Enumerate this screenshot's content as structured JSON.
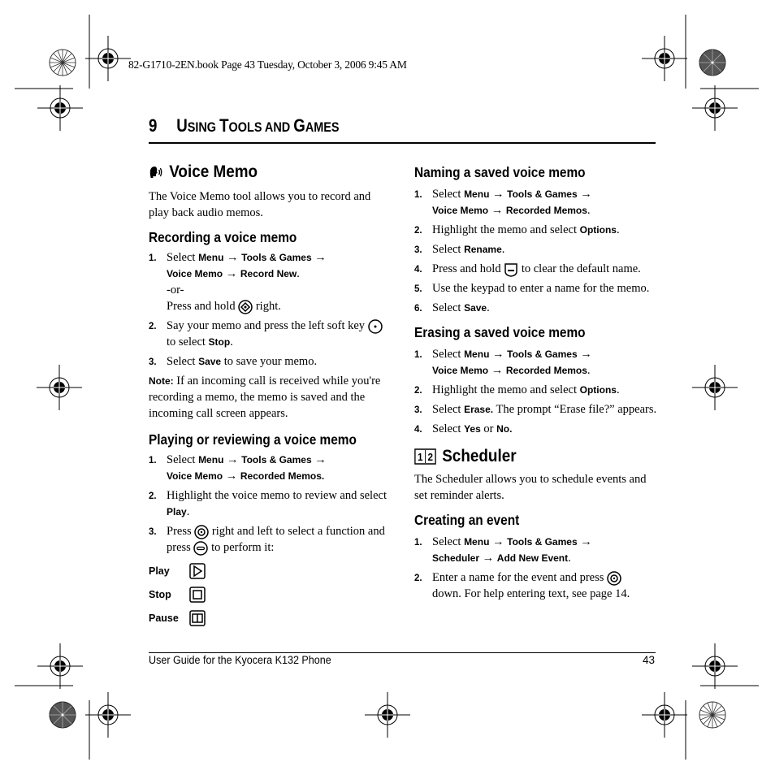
{
  "slug": "82-G1710-2EN.book  Page 43  Tuesday, October 3, 2006  9:45 AM",
  "chapter": {
    "number": "9",
    "title_parts": [
      {
        "t": "U",
        "cap": true
      },
      {
        "t": "SING ",
        "cap": false
      },
      {
        "t": "T",
        "cap": true
      },
      {
        "t": "OOLS AND ",
        "cap": false
      },
      {
        "t": "G",
        "cap": true
      },
      {
        "t": "AMES",
        "cap": false
      }
    ]
  },
  "voice_memo": {
    "title": "Voice Memo",
    "icon": "voice-memo-icon",
    "intro": "The Voice Memo tool allows you to record and play back audio memos.",
    "recording": {
      "heading": "Recording a voice memo",
      "step1_select": "Select",
      "step1_menu": "Menu",
      "step1_tools": "Tools & Games",
      "step1_voice": "Voice Memo",
      "step1_record": "Record New",
      "or": "-or-",
      "step1_alt_a": "Press and hold",
      "step1_alt_b": "right.",
      "step2_a": "Say your memo and press the left soft key",
      "step2_b": "to select",
      "step2_stop": "Stop",
      "step3_a": "Select",
      "step3_save": "Save",
      "step3_b": "to save your memo.",
      "note_label": "Note:",
      "note_text": "If an incoming call is received while you're recording a memo, the memo is saved and the incoming call screen appears."
    },
    "playing": {
      "heading": "Playing or reviewing a voice memo",
      "step1_select": "Select",
      "step1_menu": "Menu",
      "step1_tools": "Tools & Games",
      "step1_voice": "Voice Memo",
      "step1_recorded": "Recorded Memos.",
      "step2_a": "Highlight the voice memo to review and select",
      "step2_play": "Play",
      "step3_a": "Press",
      "step3_b": "right and left to select a function and press",
      "step3_c": "to perform it:",
      "controls": [
        {
          "label": "Play",
          "icon": "play-icon"
        },
        {
          "label": "Stop",
          "icon": "stop-icon"
        },
        {
          "label": "Pause",
          "icon": "pause-icon"
        }
      ]
    },
    "naming": {
      "heading": "Naming a saved voice memo",
      "step1_select": "Select",
      "step1_menu": "Menu",
      "step1_tools": "Tools & Games",
      "step1_voice": "Voice Memo",
      "step1_recorded": "Recorded Memos",
      "step2_a": "Highlight the memo and select",
      "step2_options": "Options",
      "step3_a": "Select",
      "step3_rename": "Rename",
      "step4_a": "Press and hold",
      "step4_b": "to clear the default name.",
      "step5": "Use the keypad to enter a name for the memo.",
      "step6_a": "Select",
      "step6_save": "Save"
    },
    "erasing": {
      "heading": "Erasing a saved voice memo",
      "step1_select": "Select",
      "step1_menu": "Menu",
      "step1_tools": "Tools & Games",
      "step1_voice": "Voice Memo",
      "step1_recorded": "Recorded Memos",
      "step2_a": "Highlight the memo and select",
      "step2_options": "Options",
      "step3_a": "Select",
      "step3_erase": "Erase.",
      "step3_b": "The prompt “Erase file?” appears.",
      "step4_a": "Select",
      "step4_yes": "Yes",
      "step4_or": "or",
      "step4_no": "No."
    }
  },
  "scheduler": {
    "title": "Scheduler",
    "icon": "scheduler-icon",
    "intro": "The Scheduler allows you to schedule events and set reminder alerts.",
    "creating": {
      "heading": "Creating an event",
      "step1_select": "Select",
      "step1_menu": "Menu",
      "step1_tools": "Tools & Games",
      "step1_sched": "Scheduler",
      "step1_add": "Add New Event",
      "step2_a": "Enter a name for the event and press",
      "step2_b": "down. For help entering text, see page 14."
    }
  },
  "footer": {
    "guide": "User Guide for the Kyocera K132 Phone",
    "page": "43"
  },
  "arrow": "→",
  "period": "."
}
